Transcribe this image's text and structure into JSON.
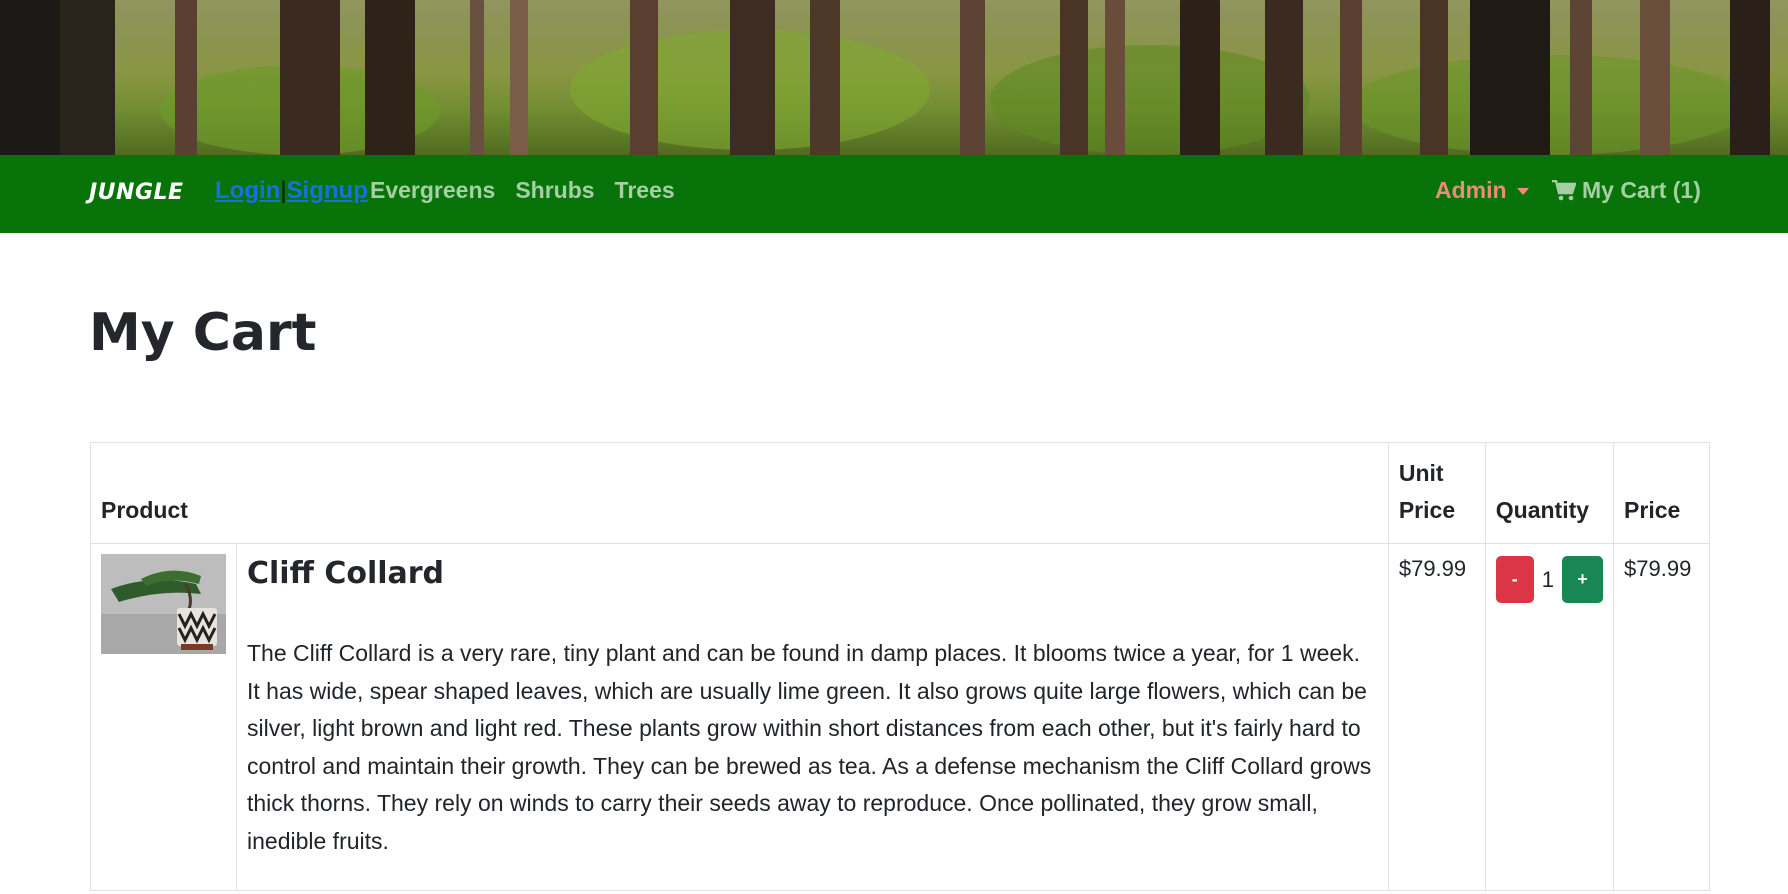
{
  "navbar": {
    "brand": "JUNGLE",
    "login": "Login",
    "separator": "|",
    "signup": "Signup",
    "categories": [
      "Evergreens",
      "Shrubs",
      "Trees"
    ],
    "admin": "Admin",
    "cart": "My Cart (1)",
    "colors": {
      "background": "#087308",
      "admin": "#f08a7a"
    }
  },
  "page": {
    "title": "My Cart"
  },
  "table": {
    "headers": {
      "product": "Product",
      "unit_price": "Unit Price",
      "quantity": "Quantity",
      "price": "Price"
    },
    "rows": [
      {
        "name": "Cliff Collard",
        "description": "The Cliff Collard is a very rare, tiny plant and can be found in damp places. It blooms twice a year, for 1 week. It has wide, spear shaped leaves, which are usually lime green. It also grows quite large flowers, which can be silver, light brown and light red. These plants grow within short distances from each other, but it's fairly hard to control and maintain their growth. They can be brewed as tea. As a defense mechanism the Cliff Collard grows thick thorns. They rely on winds to carry their seeds away to reproduce. Once pollinated, they grow small, inedible fruits.",
        "unit_price": "$79.99",
        "decrement": "-",
        "quantity": "1",
        "increment": "+",
        "price": "$79.99"
      }
    ]
  }
}
